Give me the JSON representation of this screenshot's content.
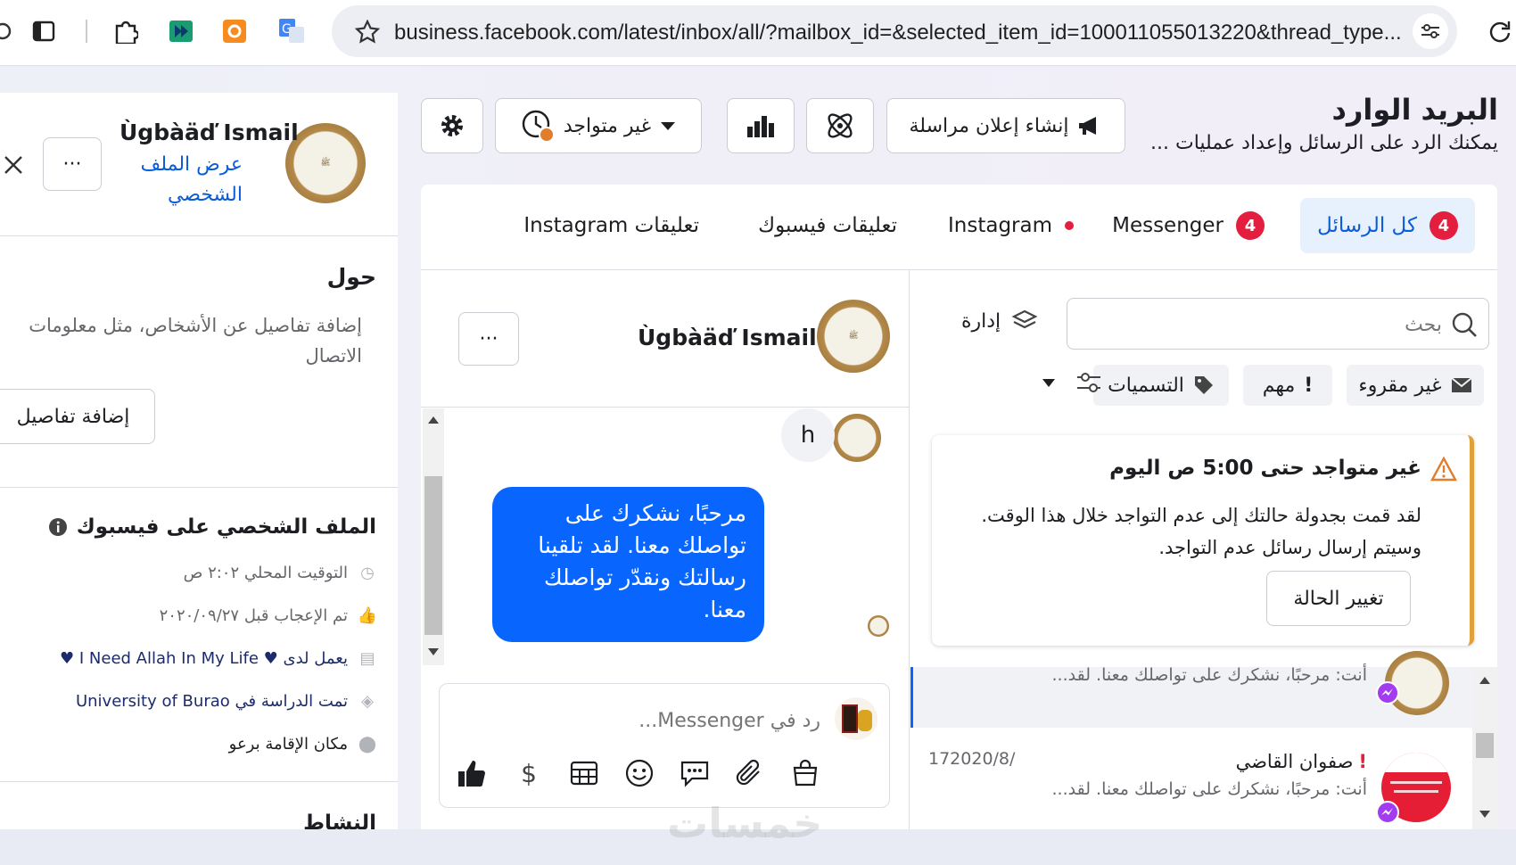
{
  "browser": {
    "url": "business.facebook.com/latest/inbox/all/?mailbox_id=&selected_item_id=100011055013220&thread_type..."
  },
  "header": {
    "title": "البريد الوارد",
    "subtitle": "يمكنك الرد على الرسائل وإعداد عمليات ...",
    "create_ad_label": "إنشاء إعلان مراسلة",
    "status_label": "غير متواجد"
  },
  "tabs": [
    {
      "label": "كل الرسائل",
      "badge": "4"
    },
    {
      "label": "Messenger",
      "badge": "4"
    },
    {
      "label": "Instagram"
    },
    {
      "label": "تعليقات فيسبوك"
    },
    {
      "label": "تعليقات Instagram"
    }
  ],
  "inbox": {
    "search_placeholder": "بحث",
    "manage_label": "إدارة",
    "filters": {
      "unread": "غير مقروء",
      "important": "مهم",
      "labels": "التسميات"
    },
    "away_notice": {
      "title": "غير متواجد حتى 5:00 ص اليوم",
      "body": "لقد قمت بجدولة حالتك إلى عدم التواجد خلال هذا الوقت. وسيتم إرسال رسائل عدم التواجد.",
      "button": "تغيير الحالة"
    },
    "threads": [
      {
        "name": "",
        "preview": "أنت: مرحبًا، نشكرك على تواصلك معنا. لقد...",
        "date": ""
      },
      {
        "name": "صفوان القاضي",
        "preview": "أنت: مرحبًا، نشكرك على تواصلك معنا. لقد...",
        "date": "172020/8/"
      }
    ]
  },
  "conversation": {
    "contact_name": "Ùgbàäď Ismail",
    "incoming_text": "h",
    "outgoing_text": "مرحبًا، نشكرك على تواصلك معنا. لقد تلقينا رسالتك ونقدّر تواصلك معنا.",
    "composer_placeholder": "رد في Messenger..."
  },
  "profile": {
    "name": "Ùgbàäď Ismail",
    "view_profile": "عرض الملف الشخصي",
    "about_title": "حول",
    "about_text": "إضافة تفاصيل عن الأشخاص، مثل معلومات الاتصال",
    "add_details": "إضافة تفاصيل",
    "fb_profile_title": "الملف الشخصي على فيسبوك",
    "local_time": "التوقيت المحلي ٢:٠٢ ص",
    "liked": "تم الإعجاب قبل ٢٠٢٠/٠٩/٢٧",
    "works_at": "يعمل لدى ♥ I Need Allah In My Life ♥",
    "studied_at": "تمت الدراسة في University of Burao",
    "lives_in": "مكان الإقامة برعو",
    "next_section": "النشاط"
  },
  "watermark": "خمسات",
  "colors": {
    "brand_blue": "#0866ff",
    "badge_red": "#e41e3f",
    "away_orange": "#e07e2e"
  }
}
